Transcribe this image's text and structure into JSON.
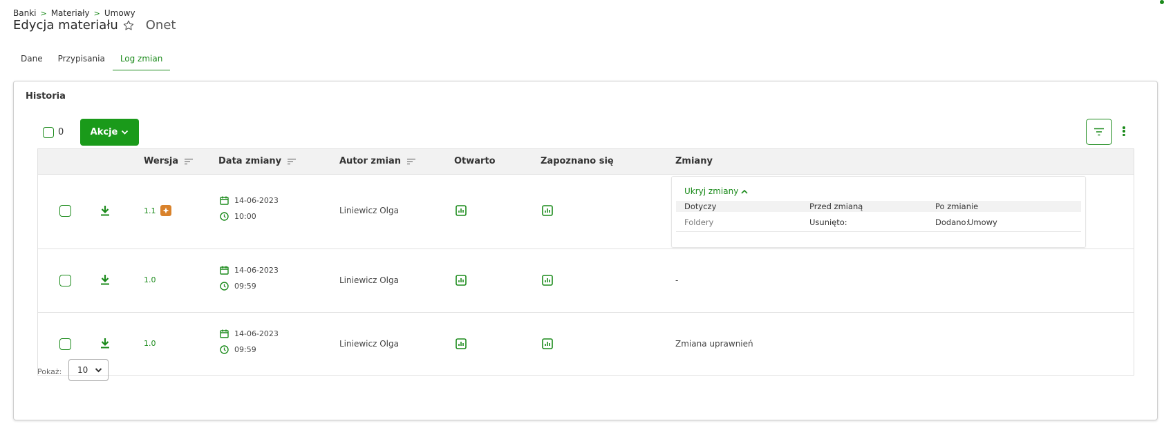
{
  "breadcrumb": [
    "Banki",
    "Materiały",
    "Umowy"
  ],
  "breadcrumb_sep": ">",
  "page": {
    "title": "Edycja materiału",
    "subtitle": "Onet"
  },
  "tabs": [
    {
      "label": "Dane",
      "active": false
    },
    {
      "label": "Przypisania",
      "active": false
    },
    {
      "label": "Log zmian",
      "active": true
    }
  ],
  "card": {
    "title": "Historia"
  },
  "toolbar": {
    "selected_count": "0",
    "actions_label": "Akcje"
  },
  "table": {
    "headers": {
      "version": "Wersja",
      "date": "Data zmiany",
      "author": "Autor zmian",
      "opened": "Otwarto",
      "acknowledged": "Zapoznano się",
      "changes": "Zmiany"
    },
    "rows": [
      {
        "version": "1.1",
        "date": "14-06-2023",
        "time": "10:00",
        "author": "Liniewicz Olga",
        "changes_expanded": true,
        "changes_detail": {
          "toggle_label": "Ukryj zmiany",
          "headers": {
            "subject": "Dotyczy",
            "before": "Przed zmianą",
            "after": "Po zmianie"
          },
          "items": [
            {
              "subject": "Foldery",
              "before_label": "Usunięto:",
              "before_value": "",
              "after_label": "Dodano:",
              "after_value": "Umowy"
            }
          ]
        }
      },
      {
        "version": "1.0",
        "date": "14-06-2023",
        "time": "09:59",
        "author": "Liniewicz Olga",
        "changes": "-"
      },
      {
        "version": "1.0",
        "date": "14-06-2023",
        "time": "09:59",
        "author": "Liniewicz Olga",
        "changes": "Zmiana uprawnień"
      }
    ]
  },
  "pagination": {
    "label": "Pokaż:",
    "page_size": "10"
  },
  "colors": {
    "accent": "#1a8a1a",
    "button": "#1a9a1a",
    "badge": "#d9822b"
  }
}
